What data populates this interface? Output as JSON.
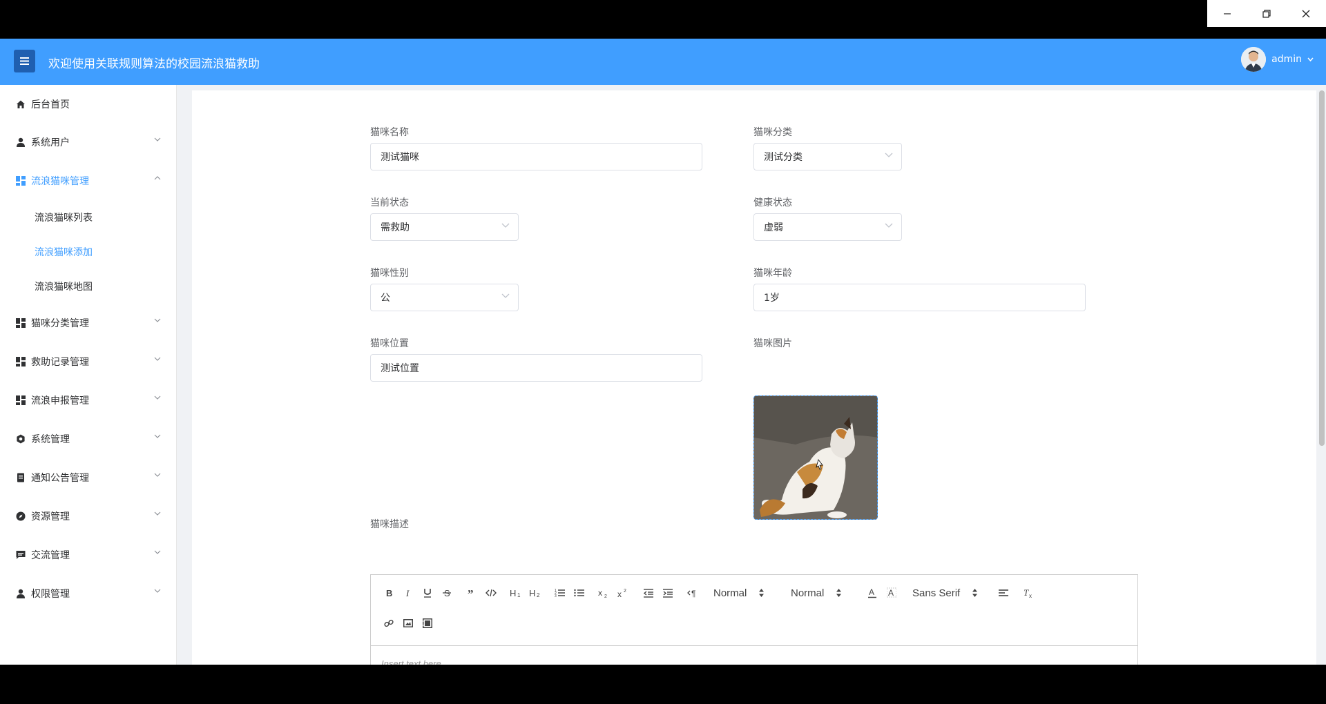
{
  "window": {
    "minimize": "—",
    "restore": "❐",
    "close": "✕"
  },
  "header": {
    "title": "欢迎使用关联规则算法的校园流浪猫救助",
    "user": "admin"
  },
  "sidebar": {
    "items": [
      {
        "label": "后台首页",
        "icon": "home-icon"
      },
      {
        "label": "系统用户",
        "icon": "user-icon"
      },
      {
        "label": "流浪猫咪管理",
        "icon": "grid-icon"
      },
      {
        "label": "猫咪分类管理",
        "icon": "grid-icon"
      },
      {
        "label": "救助记录管理",
        "icon": "grid-icon"
      },
      {
        "label": "流浪申报管理",
        "icon": "grid-icon"
      },
      {
        "label": "系统管理",
        "icon": "gear-icon"
      },
      {
        "label": "通知公告管理",
        "icon": "document-icon"
      },
      {
        "label": "资源管理",
        "icon": "compass-icon"
      },
      {
        "label": "交流管理",
        "icon": "chat-icon"
      },
      {
        "label": "权限管理",
        "icon": "user-icon"
      }
    ],
    "subitems": [
      {
        "label": "流浪猫咪列表"
      },
      {
        "label": "流浪猫咪添加"
      },
      {
        "label": "流浪猫咪地图"
      }
    ]
  },
  "form": {
    "name": {
      "label": "猫咪名称",
      "value": "测试猫咪"
    },
    "category": {
      "label": "猫咪分类",
      "value": "测试分类"
    },
    "status": {
      "label": "当前状态",
      "value": "需救助"
    },
    "health": {
      "label": "健康状态",
      "value": "虚弱"
    },
    "gender": {
      "label": "猫咪性别",
      "value": "公"
    },
    "age": {
      "label": "猫咪年龄",
      "value": "1岁"
    },
    "location": {
      "label": "猫咪位置",
      "value": "测试位置"
    },
    "image": {
      "label": "猫咪图片"
    },
    "description": {
      "label": "猫咪描述"
    }
  },
  "editor": {
    "header_select": "Normal",
    "size_select": "Normal",
    "font_select": "Sans Serif",
    "placeholder": "Insert text here ..."
  },
  "colors": {
    "primary": "#409eff",
    "menu_toggle": "#1f5fb0"
  }
}
